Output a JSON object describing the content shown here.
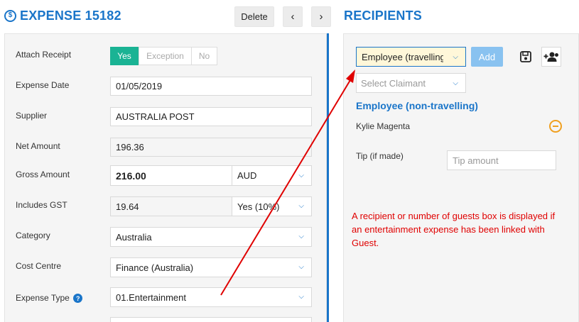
{
  "header": {
    "title": "EXPENSE 15182",
    "delete_label": "Delete",
    "prev_label": "‹",
    "next_label": "›"
  },
  "form": {
    "attach_receipt": {
      "label": "Attach Receipt",
      "options": [
        "Yes",
        "Exception",
        "No"
      ],
      "selected": "Yes"
    },
    "expense_date": {
      "label": "Expense Date",
      "value": "01/05/2019"
    },
    "supplier": {
      "label": "Supplier",
      "value": "AUSTRALIA POST"
    },
    "net_amount": {
      "label": "Net Amount",
      "value": "196.36"
    },
    "gross_amount": {
      "label": "Gross Amount",
      "value": "216.00",
      "currency": "AUD"
    },
    "includes_gst": {
      "label": "Includes GST",
      "value": "19.64",
      "option": "Yes (10%)"
    },
    "category": {
      "label": "Category",
      "value": "Australia"
    },
    "cost_centre": {
      "label": "Cost Centre",
      "value": "Finance (Australia)"
    },
    "expense_type": {
      "label": "Expense Type",
      "value": "01.Entertainment",
      "help": "?"
    }
  },
  "recipients": {
    "title": "RECIPIENTS",
    "type_select": "Employee (travelling)",
    "add_label": "Add",
    "claimant_placeholder": "Select Claimant",
    "section_heading": "Employee (non-travelling)",
    "person_name": "Kylie Magenta",
    "tip_label": "Tip (if made)",
    "tip_placeholder": "Tip amount"
  },
  "annotation": "A recipient or number of guests box is displayed if an entertainment expense has been linked with Guest.",
  "colors": {
    "accent": "#1a75c9",
    "yes_green": "#1ab394",
    "add_button": "#89c2f0",
    "annotation_red": "#e00000",
    "remove_orange": "#f0a020"
  },
  "icons": [
    "dollar-circle-icon",
    "chevron-left-icon",
    "chevron-right-icon",
    "chevron-down-icon",
    "help-icon",
    "save-icon",
    "add-user-icon",
    "remove-icon"
  ]
}
